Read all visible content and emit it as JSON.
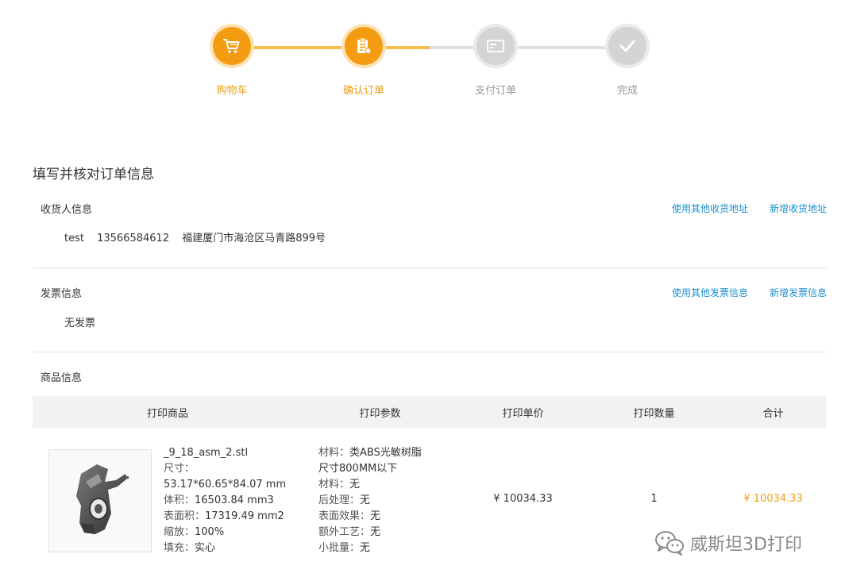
{
  "steps": [
    {
      "label": "购物车",
      "icon": "cart-icon",
      "state": "done"
    },
    {
      "label": "确认订单",
      "icon": "order-icon",
      "state": "done"
    },
    {
      "label": "支付订单",
      "icon": "card-icon",
      "state": "pending"
    },
    {
      "label": "完成",
      "icon": "check-icon",
      "state": "pending"
    }
  ],
  "colors": {
    "accent": "#f39c12",
    "accent_light": "#f5c04a",
    "link": "#1a8fd0",
    "price": "#f0a020",
    "inactive": "#d4d4d4"
  },
  "page": {
    "title": "填写并核对订单信息"
  },
  "receiver": {
    "title": "收货人信息",
    "link_other": "使用其他收货地址",
    "link_new": "新增收货地址",
    "name": "test",
    "phone": "13566584612",
    "address": "福建厦门市海沧区马青路899号"
  },
  "invoice": {
    "title": "发票信息",
    "link_other": "使用其他发票信息",
    "link_new": "新增发票信息",
    "value": "无发票"
  },
  "goods": {
    "title": "商品信息",
    "columns": [
      "打印商品",
      "打印参数",
      "打印单价",
      "打印数量",
      "合计"
    ],
    "item": {
      "filename": "_9_18_asm_2.stl",
      "size_label": "尺寸：",
      "size_value": "53.17*60.65*84.07 mm",
      "volume_label": "体积：",
      "volume_value": "16503.84 mm3",
      "area_label": "表面积：",
      "area_value": "17319.49 mm2",
      "scale_label": "缩放：",
      "scale_value": "100%",
      "fill_label": "填充：",
      "fill_value": "实心",
      "material_label": "材料：",
      "material_value": "类ABS光敏树脂",
      "material_note": "尺寸800MM以下",
      "material2_label": "材料：",
      "material2_value": "无",
      "post_label": "后处理：",
      "post_value": "无",
      "surface_label": "表面效果：",
      "surface_value": "无",
      "extra_label": "额外工艺：",
      "extra_value": "无",
      "batch_label": "小批量：",
      "batch_value": "无",
      "unit_price": "¥ 10034.33",
      "quantity": "1",
      "total": "¥ 10034.33"
    }
  },
  "watermark": {
    "text": "威斯坦3D打印",
    "icon": "wechat-icon"
  }
}
